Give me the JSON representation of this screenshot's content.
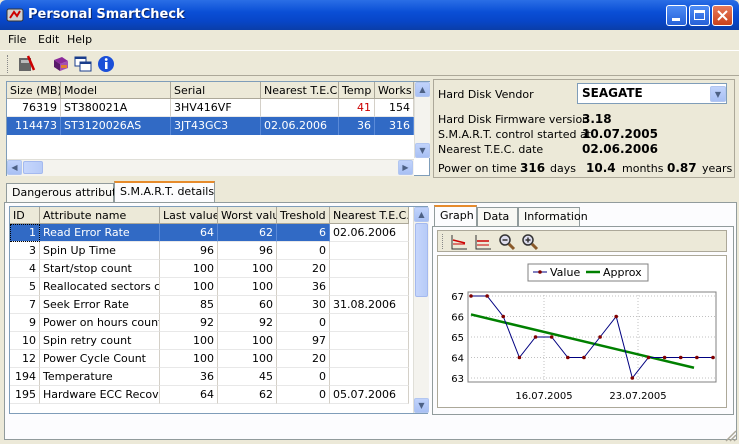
{
  "window": {
    "title": "Personal SmartCheck"
  },
  "menu": [
    "File",
    "Edit",
    "Help"
  ],
  "toolbar": {
    "icons": [
      "scan-icon",
      "book-icon",
      "windows-icon",
      "info-icon"
    ]
  },
  "disks": {
    "columns": [
      "Size (MB)",
      "Model",
      "Serial",
      "Nearest T.E.C.",
      "Temp",
      "Works"
    ],
    "rows": [
      {
        "size": "76319",
        "model": "ST380021A",
        "serial": "3HV416VF",
        "tec": "",
        "temp": "41",
        "works": "154"
      },
      {
        "size": "114473",
        "model": "ST3120026AS",
        "serial": "3JT43GC3",
        "tec": "02.06.2006",
        "temp": "36",
        "works": "316"
      }
    ]
  },
  "info": {
    "vendor_label": "Hard Disk Vendor",
    "vendor_value": "SEAGATE",
    "firmware_label": "Hard Disk Firmware version",
    "firmware_value": "3.18",
    "smart_label": "S.M.A.R.T. control started at",
    "smart_value": "10.07.2005",
    "tec_label": "Nearest T.E.C. date",
    "tec_value": "02.06.2006",
    "power_label": "Power on time",
    "days_value": "316",
    "days_unit": "days",
    "months_value": "10.4",
    "months_unit": "months",
    "years_value": "0.87",
    "years_unit": "years"
  },
  "tabs": [
    "Dangerous attributes",
    "S.M.A.R.T. details"
  ],
  "attributes": {
    "columns": [
      "ID",
      "Attribute name",
      "Last value",
      "Worst value",
      "Treshold",
      "Nearest T.E.C."
    ],
    "rows": [
      {
        "id": "1",
        "name": "Read Error Rate",
        "last": "64",
        "worst": "62",
        "thr": "6",
        "tec": "02.06.2006"
      },
      {
        "id": "3",
        "name": "Spin Up Time",
        "last": "96",
        "worst": "96",
        "thr": "0",
        "tec": ""
      },
      {
        "id": "4",
        "name": "Start/stop count",
        "last": "100",
        "worst": "100",
        "thr": "20",
        "tec": ""
      },
      {
        "id": "5",
        "name": "Reallocated sectors count",
        "last": "100",
        "worst": "100",
        "thr": "36",
        "tec": ""
      },
      {
        "id": "7",
        "name": "Seek Error Rate",
        "last": "85",
        "worst": "60",
        "thr": "30",
        "tec": "31.08.2006"
      },
      {
        "id": "9",
        "name": "Power on hours count",
        "last": "92",
        "worst": "92",
        "thr": "0",
        "tec": ""
      },
      {
        "id": "10",
        "name": "Spin retry count",
        "last": "100",
        "worst": "100",
        "thr": "97",
        "tec": ""
      },
      {
        "id": "12",
        "name": "Power Cycle Count",
        "last": "100",
        "worst": "100",
        "thr": "20",
        "tec": ""
      },
      {
        "id": "194",
        "name": "Temperature",
        "last": "36",
        "worst": "45",
        "thr": "0",
        "tec": ""
      },
      {
        "id": "195",
        "name": "Hardware ECC Recovered",
        "last": "64",
        "worst": "62",
        "thr": "0",
        "tec": "05.07.2006"
      }
    ]
  },
  "detail_tabs": [
    "Graph",
    "Data",
    "Information"
  ],
  "graph_tools": [
    "zoom-reset-icon",
    "zoom-fit-icon",
    "zoom-out-icon",
    "zoom-in-icon"
  ],
  "chart_data": {
    "type": "line",
    "title": "",
    "legend": [
      "Value",
      "Approx"
    ],
    "legend_position": "top",
    "ylim": [
      63,
      67
    ],
    "yticks": [
      "63",
      "64",
      "65",
      "66",
      "67"
    ],
    "xticks": [
      "16.07.2005",
      "23.07.2005"
    ],
    "series": [
      {
        "name": "Value",
        "color": "#000080",
        "values": [
          67,
          67,
          66,
          64,
          65,
          65,
          64,
          64,
          65,
          66,
          63,
          64,
          64,
          64,
          64,
          64
        ]
      },
      {
        "name": "Approx",
        "color": "#008000",
        "values": [
          66.1,
          63.5
        ]
      }
    ],
    "grid": true
  },
  "colors": {
    "selection": "#316ac5",
    "temp_warn": "#cc0000"
  }
}
